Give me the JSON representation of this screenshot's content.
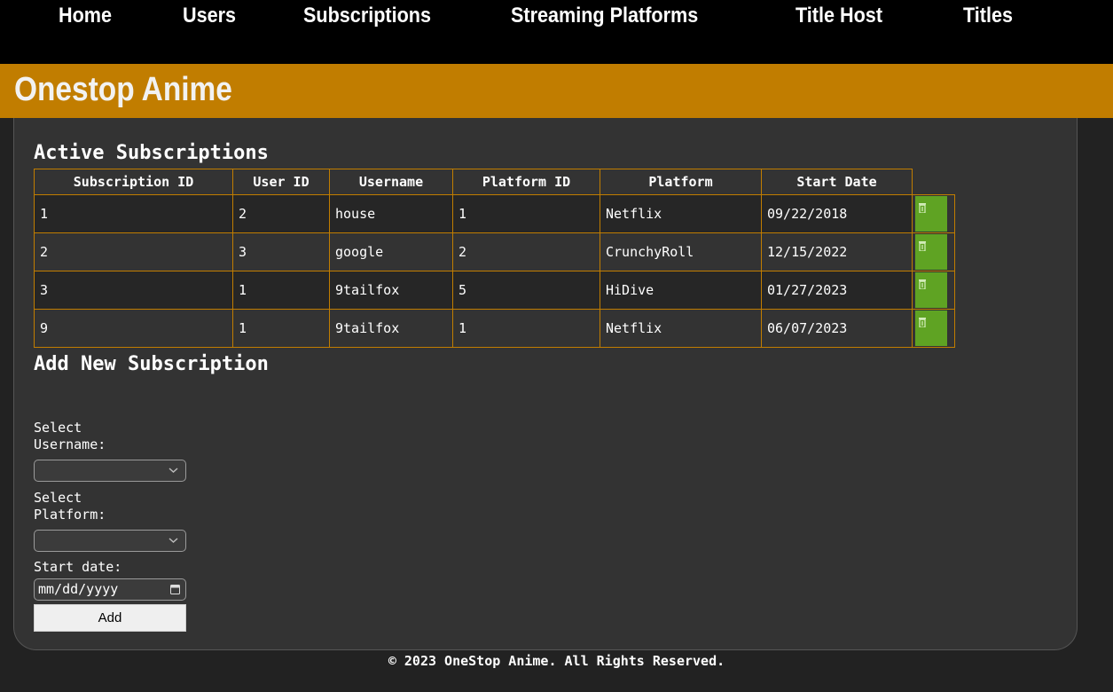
{
  "nav": {
    "items": [
      "Home",
      "Users",
      "Subscriptions",
      "Streaming Platforms",
      "Title Host",
      "Titles"
    ]
  },
  "brand": {
    "title": "Onestop Anime",
    "color": "#c17d00"
  },
  "active": {
    "title": "Active Subscriptions",
    "headers": [
      "Subscription ID",
      "User ID",
      "Username",
      "Platform ID",
      "Platform",
      "Start Date"
    ],
    "rows": [
      [
        "1",
        "2",
        "house",
        "1",
        "Netflix",
        "09/22/2018"
      ],
      [
        "2",
        "3",
        "google",
        "2",
        "CrunchyRoll",
        "12/15/2022"
      ],
      [
        "3",
        "1",
        "9tailfox",
        "5",
        "HiDive",
        "01/27/2023"
      ],
      [
        "9",
        "1",
        "9tailfox",
        "1",
        "Netflix",
        "06/07/2023"
      ]
    ],
    "delete_icon": "trash-icon",
    "delete_color": "#5fa323"
  },
  "form": {
    "title": "Add New Subscription",
    "username_label": "Select\nUsername:",
    "username_value": "",
    "platform_label": "Select\nPlatform:",
    "platform_value": "",
    "date_label": "Start date:",
    "date_placeholder": "mm/dd/yyyy",
    "add_label": "Add"
  },
  "footer": {
    "text": "© 2023 OneStop Anime. All Rights Reserved."
  }
}
